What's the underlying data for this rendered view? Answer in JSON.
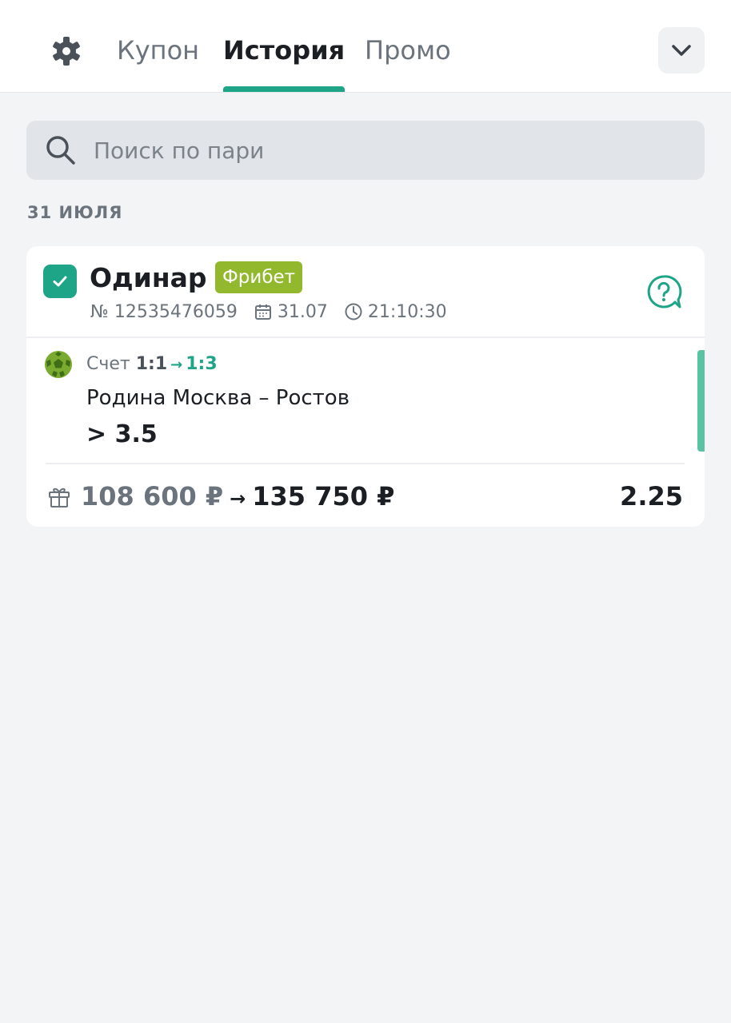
{
  "tabs": [
    {
      "label": "Купон",
      "active": false
    },
    {
      "label": "История",
      "active": true
    },
    {
      "label": "Промо",
      "active": false
    }
  ],
  "search": {
    "placeholder": "Поиск по пари",
    "value": ""
  },
  "date_heading": "31 ИЮЛЯ",
  "bet": {
    "type": "Одинар",
    "badge": "Фрибет",
    "number": "№ 12535476059",
    "date": "31.07",
    "time": "21:10:30",
    "score_label": "Счет",
    "score_old": "1:1",
    "score_arrow": "→",
    "score_new": "1:3",
    "match": "Родина Москва – Ростов",
    "selection": "> 3.5",
    "stake": "108 600 ₽",
    "amount_arrow": "→",
    "payout": "135 750 ₽",
    "odds": "2.25"
  },
  "icons": {
    "settings": "gear-icon",
    "collapse": "chevron-down-icon",
    "search": "search-icon",
    "checkbox": "check-icon",
    "help": "question-bubble-icon",
    "date": "calendar-icon",
    "time": "clock-icon",
    "sport": "football-icon",
    "freebet": "gift-icon"
  },
  "colors": {
    "accent": "#1ea486",
    "badge": "#92b82e",
    "background": "#f2f4f6"
  }
}
